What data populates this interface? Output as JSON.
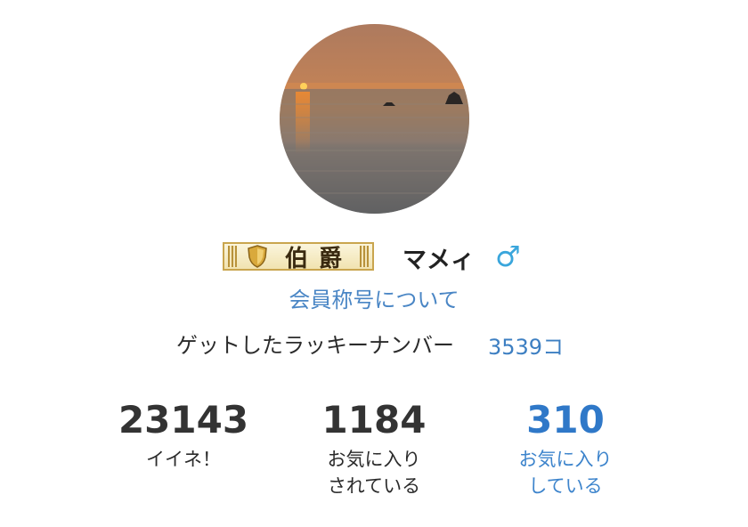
{
  "profile": {
    "avatar_icon": "sunset-sea-photo",
    "rank": {
      "text": "伯爵",
      "icon": "shield-icon",
      "border_color": "#c9a54e"
    },
    "name": "マメィ",
    "gender_symbol": "♂",
    "gender_color": "#3aa6dc",
    "title_link": "会員称号について",
    "lucky_label": "ゲットしたラッキーナンバー",
    "lucky_count": "3539コ"
  },
  "stats": [
    {
      "value": "23143",
      "label_lines": [
        "イイネ！"
      ]
    },
    {
      "value": "1184",
      "label_lines": [
        "お気に入り",
        "されている"
      ]
    },
    {
      "value": "310",
      "label_lines": [
        "お気に入り",
        "している"
      ]
    }
  ],
  "colors": {
    "link_blue": "#4a86c5",
    "stat_blue": "#2f78c8",
    "text": "#2b2b2b"
  }
}
